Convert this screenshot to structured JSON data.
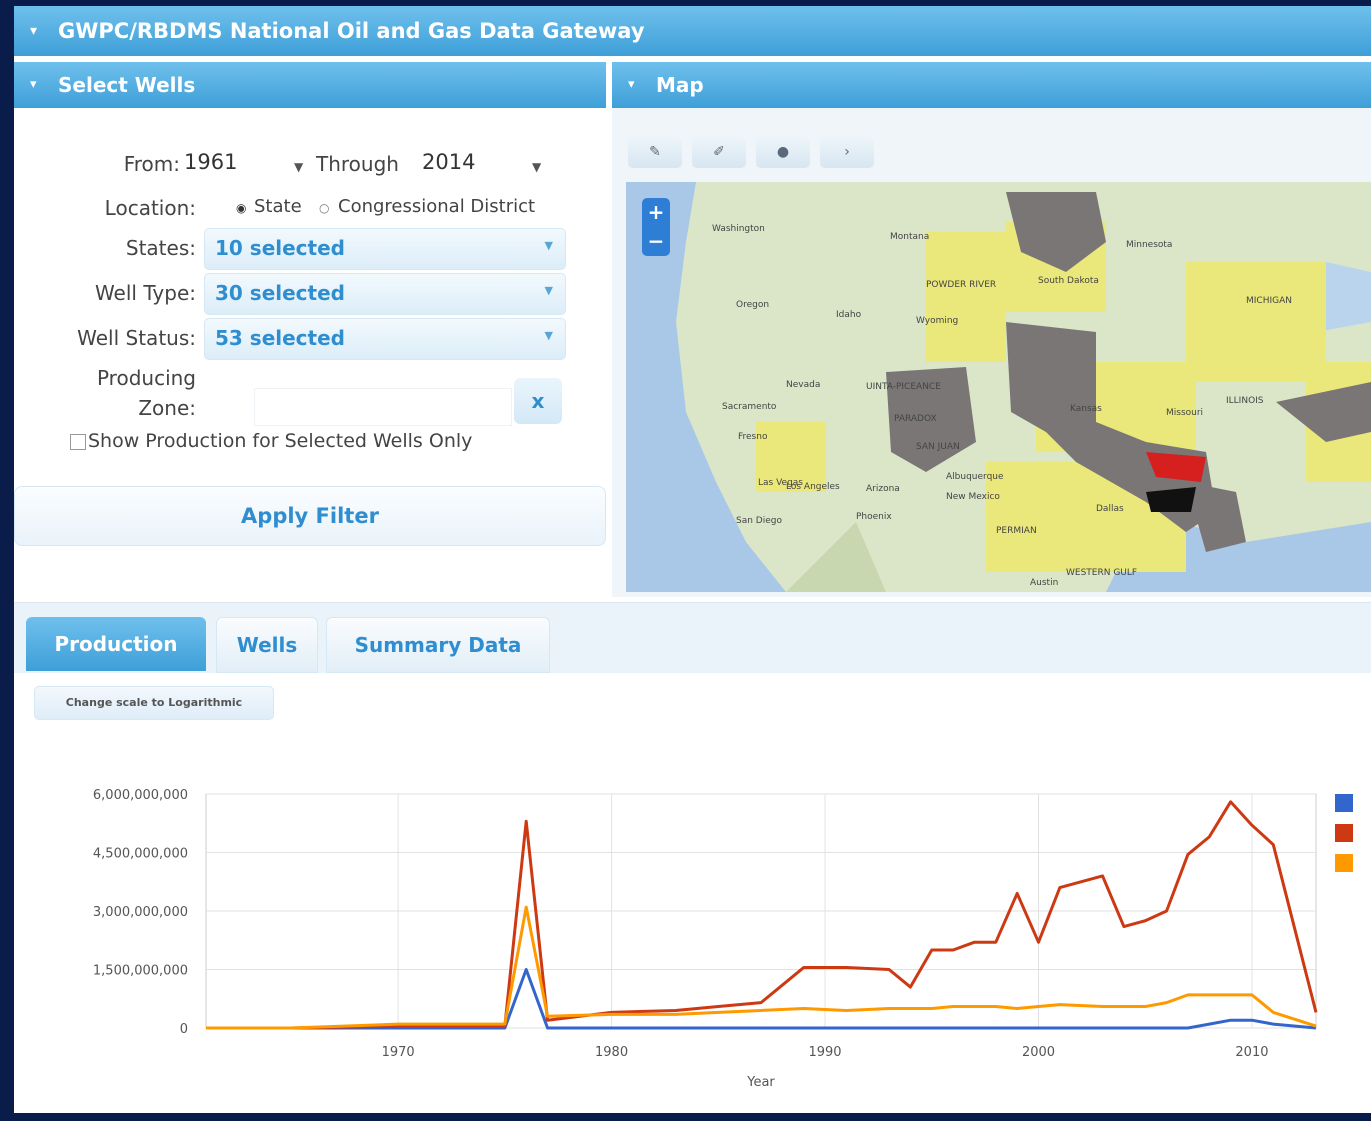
{
  "app": {
    "title": "GWPC/RBDMS National Oil and Gas Data Gateway"
  },
  "select_panel": {
    "title": "Select Wells",
    "from_label": "From:",
    "from_value": "1961",
    "through_label": "Through",
    "through_value": "2014",
    "location_label": "Location:",
    "location_options": [
      "State",
      "Congressional District"
    ],
    "location_selected": "State",
    "states_label": "States:",
    "states_value": "10 selected",
    "well_type_label": "Well Type:",
    "well_type_value": "30 selected",
    "well_status_label": "Well Status:",
    "well_status_value": "53 selected",
    "producing_label": "Producing",
    "zone_label": "Zone:",
    "zone_value": "",
    "zone_clear": "x",
    "show_production_label": "Show Production for Selected Wells Only",
    "apply_label": "Apply Filter"
  },
  "map_panel": {
    "title": "Map",
    "tools": [
      "wrench-icon",
      "pencil-icon",
      "dot-icon",
      "arrow-icon"
    ],
    "zoom_in": "+",
    "zoom_out": "−",
    "places": [
      "Washington",
      "Montana",
      "POWDER RIVER",
      "South Dakota",
      "Minnesota",
      "MICHIGAN",
      "Oregon",
      "Idaho",
      "Wyoming",
      "Nevada",
      "UINTA-PICEANCE",
      "PARADOX",
      "SAN JUAN",
      "Kansas",
      "Missouri",
      "ILLINOIS",
      "Las Vegas",
      "Los Angeles",
      "San Diego",
      "Arizona",
      "Phoenix",
      "New Mexico",
      "PERMIAN",
      "Dallas",
      "WESTERN GULF",
      "Austin",
      "Albuquerque",
      "Fresno",
      "Sacramento"
    ]
  },
  "tabs": {
    "production": "Production",
    "wells": "Wells",
    "summary": "Summary Data",
    "active": "production"
  },
  "log_button": "Change scale to Logarithmic",
  "colors": {
    "header": "#3e9fd8",
    "oil": "#3366cc",
    "gas": "#cc3912",
    "water": "#ff9900"
  },
  "chart_data": {
    "type": "line",
    "title": "",
    "xlabel": "Year",
    "ylabel": "",
    "ylim": [
      0,
      6000000000
    ],
    "y_ticks": [
      "0",
      "1,500,000,000",
      "3,000,000,000",
      "4,500,000,000",
      "6,000,000,000"
    ],
    "x_ticks": [
      "1970",
      "1980",
      "1990",
      "2000",
      "2010"
    ],
    "legend": "right",
    "x": [
      1961,
      1965,
      1970,
      1975,
      1976,
      1977,
      1980,
      1983,
      1985,
      1987,
      1989,
      1991,
      1993,
      1994,
      1995,
      1996,
      1997,
      1998,
      1999,
      2000,
      2001,
      2003,
      2004,
      2005,
      2006,
      2007,
      2008,
      2009,
      2010,
      2011,
      2013
    ],
    "series": [
      {
        "color": "#3366cc",
        "values": [
          0,
          0,
          0,
          0,
          1500000000,
          0,
          0,
          0,
          0,
          0,
          0,
          0,
          0,
          0,
          0,
          0,
          0,
          0,
          0,
          0,
          0,
          0,
          0,
          0,
          0,
          0,
          100000000,
          200000000,
          200000000,
          100000000,
          0
        ]
      },
      {
        "color": "#cc3912",
        "values": [
          0,
          0,
          50000000,
          50000000,
          5300000000,
          200000000,
          400000000,
          450000000,
          550000000,
          650000000,
          1550000000,
          1550000000,
          1500000000,
          1050000000,
          2000000000,
          2000000000,
          2200000000,
          2200000000,
          3450000000,
          2200000000,
          3600000000,
          3900000000,
          2600000000,
          2750000000,
          3000000000,
          4450000000,
          4900000000,
          5800000000,
          5200000000,
          4700000000,
          400000000
        ]
      },
      {
        "color": "#ff9900",
        "values": [
          0,
          0,
          100000000,
          100000000,
          3100000000,
          300000000,
          350000000,
          350000000,
          400000000,
          450000000,
          500000000,
          450000000,
          500000000,
          500000000,
          500000000,
          550000000,
          550000000,
          550000000,
          500000000,
          550000000,
          600000000,
          550000000,
          550000000,
          550000000,
          650000000,
          850000000,
          850000000,
          850000000,
          850000000,
          400000000,
          50000000
        ]
      }
    ]
  }
}
